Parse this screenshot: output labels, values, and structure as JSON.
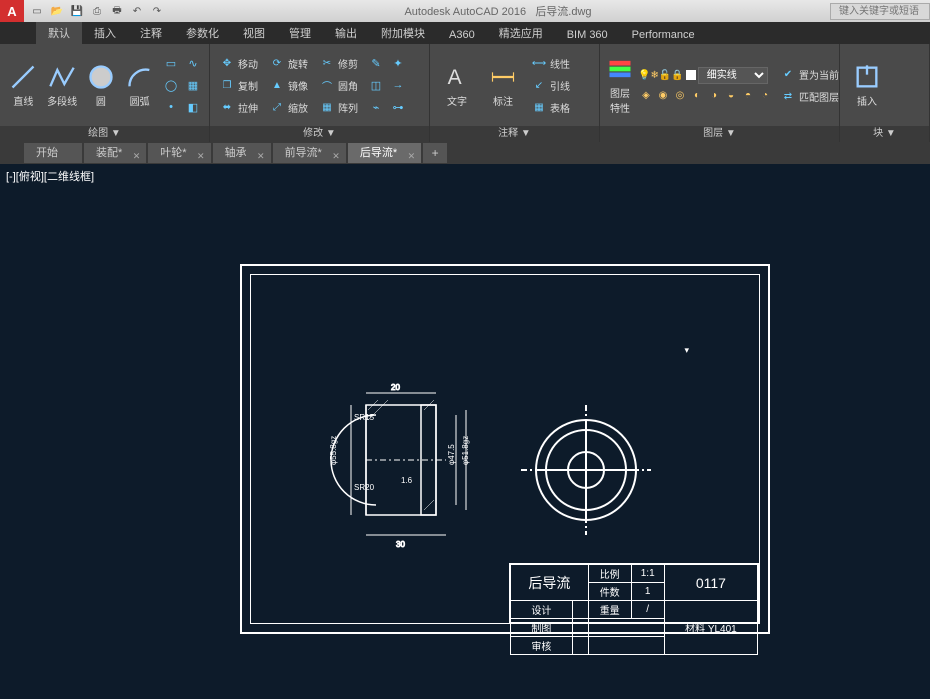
{
  "app": {
    "title": "Autodesk AutoCAD 2016",
    "doc": "后导流.dwg",
    "search_placeholder": "键入关键字或短语",
    "logo": "A"
  },
  "menutabs": [
    "默认",
    "插入",
    "注释",
    "参数化",
    "视图",
    "管理",
    "输出",
    "附加模块",
    "A360",
    "精选应用",
    "BIM 360",
    "Performance"
  ],
  "ribbon": {
    "draw": {
      "title": "绘图 ▼",
      "line": "直线",
      "polyline": "多段线",
      "circle": "圆",
      "arc": "圆弧"
    },
    "modify": {
      "title": "修改 ▼",
      "move": "移动",
      "copy": "复制",
      "stretch": "拉伸",
      "rotate": "旋转",
      "mirror": "镜像",
      "scale": "缩放",
      "trim": "修剪",
      "fillet": "圆角",
      "array": "阵列"
    },
    "annot": {
      "title": "注释 ▼",
      "text": "文字",
      "dim": "标注",
      "linear": "线性",
      "leader": "引线",
      "table": "表格"
    },
    "layer": {
      "title": "图层 ▼",
      "props": "图层\n特性",
      "current": "细实线",
      "setcurrent": "置为当前",
      "match": "匹配图层"
    },
    "block": {
      "title": "块 ▼",
      "insert": "插入"
    }
  },
  "doctabs": [
    {
      "label": "开始",
      "dirty": false
    },
    {
      "label": "装配*",
      "dirty": true
    },
    {
      "label": "叶轮*",
      "dirty": true
    },
    {
      "label": "轴承",
      "dirty": false
    },
    {
      "label": "前导流*",
      "dirty": true
    },
    {
      "label": "后导流*",
      "dirty": true,
      "active": true
    }
  ],
  "viewport_label": "[-][俯视][二维线框]",
  "drawing": {
    "part_name": "后导流",
    "dims": {
      "width": "30",
      "top": "20",
      "hatch": "1.6",
      "h1": "SR15",
      "h2": "SR20",
      "d1": "φ55.8gz",
      "d2": "φ47.5",
      "d3": "φ51.8gz"
    },
    "titleblock": {
      "scale_label": "比例",
      "scale": "1:1",
      "qty_label": "件数",
      "qty": "1",
      "number": "0117",
      "mass_label": "重量",
      "mass": "/",
      "mat_label": "材料",
      "material": "YL401",
      "design": "设计",
      "section": "制图",
      "check": "审核"
    }
  }
}
